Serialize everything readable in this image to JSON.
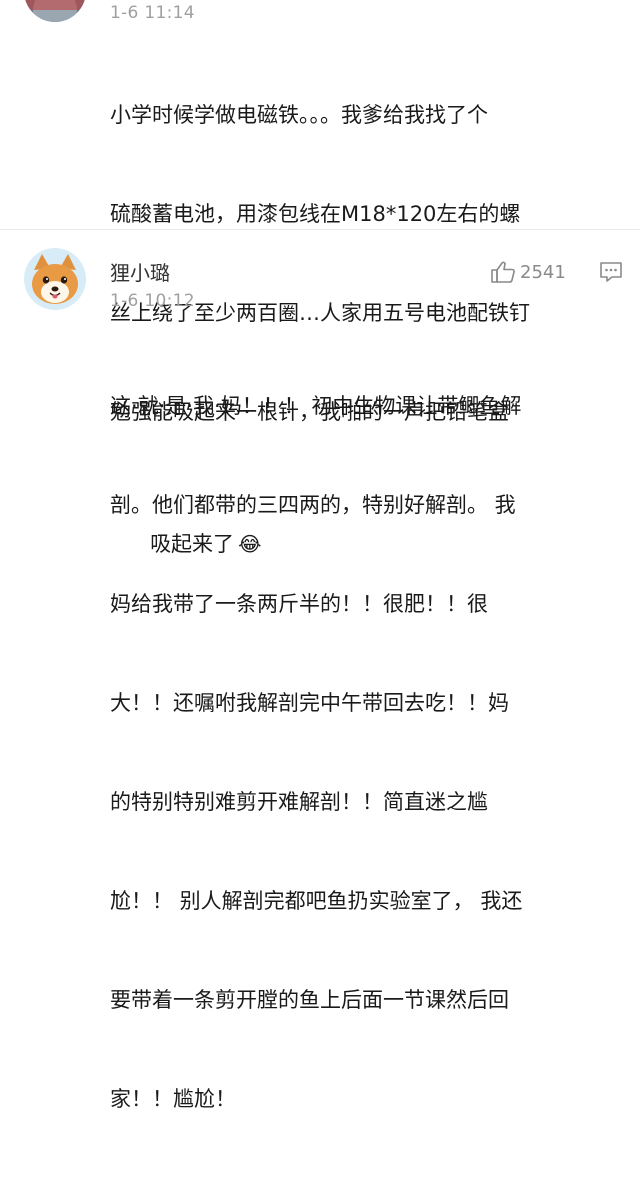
{
  "comment_top": {
    "timestamp": "1-6 11:14",
    "lines": [
      "小学时候学做电磁铁。。。我爹给我找了个",
      "硫酸蓄电池，用漆包线在M18*120左右的螺",
      "丝上绕了至少两百圈…人家用五号电池配铁钉",
      "勉强能吸起来一根针，我啪的一声把铅笔盒",
      "吸起来了"
    ],
    "emoji": "😂"
  },
  "comment_main": {
    "username": "狸小璐",
    "timestamp": "1-6 10:12",
    "like_count": "2541",
    "lines": [
      "这·就·是·我·妈！！！ 初中生物课让带鲫鱼解",
      "剖。他们都带的三四两的，特别好解剖。 我",
      "妈给我带了一条两斤半的！！很肥！！很",
      "大！！还嘱咐我解剖完中午带回去吃！！妈",
      "的特别特别难剪开难解剖！！简直迷之尴",
      "尬！！ 别人解剖完都吧鱼扔实验室了， 我还",
      "要带着一条剪开膛的鱼上后面一节课然后回",
      "家！！尴尬！"
    ]
  },
  "colors": {
    "text": "#1a1a1a",
    "muted": "#a0a0a0",
    "icon": "#8a8a8a",
    "divider": "#e8e8e8"
  }
}
